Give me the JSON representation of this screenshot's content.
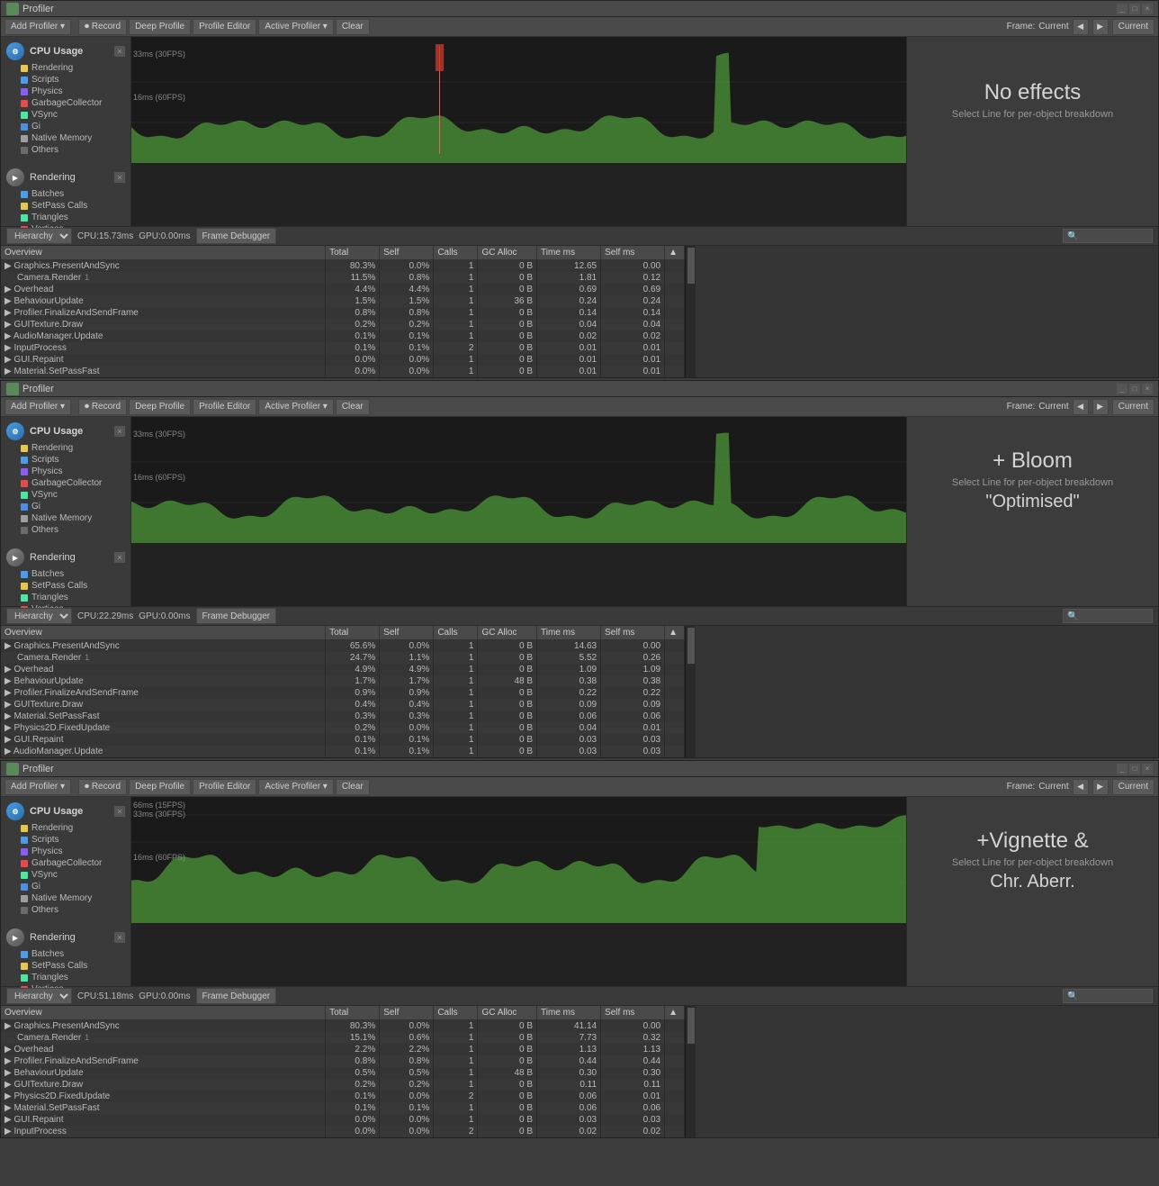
{
  "windows": [
    {
      "id": "window1",
      "titleBar": "Profiler",
      "toolbar": {
        "addProfiler": "Add Profiler",
        "record": "Record",
        "deepProfile": "Deep Profile",
        "profileEditor": "Profile Editor",
        "activeProfiler": "Active Profiler",
        "clear": "Clear",
        "frame": "Frame:",
        "current": "Current",
        "currentBtn": "Current"
      },
      "cpu": {
        "label": "CPU Usage",
        "items": [
          {
            "color": "#e8c84a",
            "label": "Rendering"
          },
          {
            "color": "#4a9de8",
            "label": "Scripts"
          },
          {
            "color": "#8b5cf6",
            "label": "Physics"
          },
          {
            "color": "#e84a4a",
            "label": "GarbageCollector"
          },
          {
            "color": "#4ae8a0",
            "label": "VSync"
          },
          {
            "color": "#4a90e8",
            "label": "Gi"
          },
          {
            "color": "#9e9e9e",
            "label": "Native Memory"
          },
          {
            "color": "#6b6b6b",
            "label": "Others"
          }
        ],
        "chart30fps": "33ms (30FPS)",
        "chart60fps": "16ms (60FPS)"
      },
      "rendering": {
        "label": "Rendering",
        "items": [
          {
            "color": "#4a9de8",
            "label": "Batches"
          },
          {
            "color": "#e8c84a",
            "label": "SetPass Calls"
          },
          {
            "color": "#4ae8a0",
            "label": "Triangles"
          },
          {
            "color": "#e84a4a",
            "label": "Vertices"
          }
        ]
      },
      "bottomBar": {
        "hierarchy": "Hierarchy",
        "cpu": "CPU:15.73ms",
        "gpu": "GPU:0.00ms",
        "frameDebugger": "Frame Debugger"
      },
      "table": {
        "headers": [
          "Overview",
          "Total",
          "Self",
          "Calls",
          "GC Alloc",
          "Time ms",
          "Self ms",
          ""
        ],
        "rows": [
          {
            "name": "Graphics.PresentAndSync",
            "total": "80.3%",
            "self": "0.0%",
            "calls": "1",
            "gcAlloc": "0 B",
            "timeMs": "12.65",
            "selfMs": "0.00",
            "indent": 0
          },
          {
            "name": "Camera.Render",
            "total": "11.5%",
            "self": "0.8%",
            "calls": "1",
            "gcAlloc": "0 B",
            "timeMs": "1.81",
            "selfMs": "0.12",
            "indent": 1,
            "extra": "1"
          },
          {
            "name": "Overhead",
            "total": "4.4%",
            "self": "4.4%",
            "calls": "1",
            "gcAlloc": "0 B",
            "timeMs": "0.69",
            "selfMs": "0.69",
            "indent": 0
          },
          {
            "name": "BehaviourUpdate",
            "total": "1.5%",
            "self": "1.5%",
            "calls": "1",
            "gcAlloc": "36 B",
            "timeMs": "0.24",
            "selfMs": "0.24",
            "indent": 0
          },
          {
            "name": "Profiler.FinalizeAndSendFrame",
            "total": "0.8%",
            "self": "0.8%",
            "calls": "1",
            "gcAlloc": "0 B",
            "timeMs": "0.14",
            "selfMs": "0.14",
            "indent": 0
          },
          {
            "name": "GUITexture.Draw",
            "total": "0.2%",
            "self": "0.2%",
            "calls": "1",
            "gcAlloc": "0 B",
            "timeMs": "0.04",
            "selfMs": "0.04",
            "indent": 0
          },
          {
            "name": "AudioManager.Update",
            "total": "0.1%",
            "self": "0.1%",
            "calls": "1",
            "gcAlloc": "0 B",
            "timeMs": "0.02",
            "selfMs": "0.02",
            "indent": 0
          },
          {
            "name": "InputProcess",
            "total": "0.1%",
            "self": "0.1%",
            "calls": "2",
            "gcAlloc": "0 B",
            "timeMs": "0.01",
            "selfMs": "0.01",
            "indent": 0
          },
          {
            "name": "GUI.Repaint",
            "total": "0.0%",
            "self": "0.0%",
            "calls": "1",
            "gcAlloc": "0 B",
            "timeMs": "0.01",
            "selfMs": "0.01",
            "indent": 0
          },
          {
            "name": "Material.SetPassFast",
            "total": "0.0%",
            "self": "0.0%",
            "calls": "1",
            "gcAlloc": "0 B",
            "timeMs": "0.01",
            "selfMs": "0.01",
            "indent": 0
          }
        ]
      },
      "infoPanel": {
        "title": "No effects",
        "subtitle": "Select Line for per-object breakdown"
      }
    },
    {
      "id": "window2",
      "titleBar": "Profiler",
      "toolbar": {
        "addProfiler": "Add Profiler",
        "record": "Record",
        "deepProfile": "Deep Profile",
        "profileEditor": "Profile Editor",
        "activeProfiler": "Active Profiler",
        "clear": "Clear",
        "frame": "Frame:",
        "current": "Current",
        "currentBtn": "Current"
      },
      "cpu": {
        "label": "CPU Usage",
        "chart30fps": "33ms (30FPS)",
        "chart60fps": "16ms (60FPS)",
        "items": [
          {
            "color": "#e8c84a",
            "label": "Rendering"
          },
          {
            "color": "#4a9de8",
            "label": "Scripts"
          },
          {
            "color": "#8b5cf6",
            "label": "Physics"
          },
          {
            "color": "#e84a4a",
            "label": "GarbageCollector"
          },
          {
            "color": "#4ae8a0",
            "label": "VSync"
          },
          {
            "color": "#4a90e8",
            "label": "Gi"
          },
          {
            "color": "#9e9e9e",
            "label": "Native Memory"
          },
          {
            "color": "#6b6b6b",
            "label": "Others"
          }
        ]
      },
      "rendering": {
        "label": "Rendering",
        "items": [
          {
            "color": "#4a9de8",
            "label": "Batches"
          },
          {
            "color": "#e8c84a",
            "label": "SetPass Calls"
          },
          {
            "color": "#4ae8a0",
            "label": "Triangles"
          },
          {
            "color": "#e84a4a",
            "label": "Vertices"
          }
        ]
      },
      "bottomBar": {
        "hierarchy": "Hierarchy",
        "cpu": "CPU:22.29ms",
        "gpu": "GPU:0.00ms",
        "frameDebugger": "Frame Debugger"
      },
      "table": {
        "headers": [
          "Overview",
          "Total",
          "Self",
          "Calls",
          "GC Alloc",
          "Time ms",
          "Self ms",
          ""
        ],
        "rows": [
          {
            "name": "Graphics.PresentAndSync",
            "total": "65.6%",
            "self": "0.0%",
            "calls": "1",
            "gcAlloc": "0 B",
            "timeMs": "14.63",
            "selfMs": "0.00",
            "indent": 0
          },
          {
            "name": "Camera.Render",
            "total": "24.7%",
            "self": "1.1%",
            "calls": "1",
            "gcAlloc": "0 B",
            "timeMs": "5.52",
            "selfMs": "0.26",
            "indent": 1,
            "extra": "1"
          },
          {
            "name": "Overhead",
            "total": "4.9%",
            "self": "4.9%",
            "calls": "1",
            "gcAlloc": "0 B",
            "timeMs": "1.09",
            "selfMs": "1.09",
            "indent": 0
          },
          {
            "name": "BehaviourUpdate",
            "total": "1.7%",
            "self": "1.7%",
            "calls": "1",
            "gcAlloc": "48 B",
            "timeMs": "0.38",
            "selfMs": "0.38",
            "indent": 0
          },
          {
            "name": "Profiler.FinalizeAndSendFrame",
            "total": "0.9%",
            "self": "0.9%",
            "calls": "1",
            "gcAlloc": "0 B",
            "timeMs": "0.22",
            "selfMs": "0.22",
            "indent": 0
          },
          {
            "name": "GUITexture.Draw",
            "total": "0.4%",
            "self": "0.4%",
            "calls": "1",
            "gcAlloc": "0 B",
            "timeMs": "0.09",
            "selfMs": "0.09",
            "indent": 0
          },
          {
            "name": "Material.SetPassFast",
            "total": "0.3%",
            "self": "0.3%",
            "calls": "1",
            "gcAlloc": "0 B",
            "timeMs": "0.06",
            "selfMs": "0.06",
            "indent": 0
          },
          {
            "name": "Physics2D.FixedUpdate",
            "total": "0.2%",
            "self": "0.0%",
            "calls": "1",
            "gcAlloc": "0 B",
            "timeMs": "0.04",
            "selfMs": "0.01",
            "indent": 0
          },
          {
            "name": "GUI.Repaint",
            "total": "0.1%",
            "self": "0.1%",
            "calls": "1",
            "gcAlloc": "0 B",
            "timeMs": "0.03",
            "selfMs": "0.03",
            "indent": 0
          },
          {
            "name": "AudioManager.Update",
            "total": "0.1%",
            "self": "0.1%",
            "calls": "1",
            "gcAlloc": "0 B",
            "timeMs": "0.03",
            "selfMs": "0.03",
            "indent": 0
          }
        ]
      },
      "infoPanel": {
        "title": "+ Bloom",
        "subtitle": "Select Line for per-object breakdown",
        "subtitle2": "\"Optimised\""
      }
    },
    {
      "id": "window3",
      "titleBar": "Profiler",
      "toolbar": {
        "addProfiler": "Add Profiler",
        "record": "Record",
        "deepProfile": "Deep Profile",
        "profileEditor": "Profile Editor",
        "activeProfiler": "Active Profiler",
        "clear": "Clear",
        "frame": "Frame:",
        "current": "Current",
        "currentBtn": "Current"
      },
      "cpu": {
        "label": "CPU Usage",
        "chart15fps": "66ms (15FPS)",
        "chart30fps": "33ms (30FPS)",
        "chart60fps": "16ms (60FPS)",
        "items": [
          {
            "color": "#e8c84a",
            "label": "Rendering"
          },
          {
            "color": "#4a9de8",
            "label": "Scripts"
          },
          {
            "color": "#8b5cf6",
            "label": "Physics"
          },
          {
            "color": "#e84a4a",
            "label": "GarbageCollector"
          },
          {
            "color": "#4ae8a0",
            "label": "VSync"
          },
          {
            "color": "#4a90e8",
            "label": "Gi"
          },
          {
            "color": "#9e9e9e",
            "label": "Native Memory"
          },
          {
            "color": "#6b6b6b",
            "label": "Others"
          }
        ]
      },
      "rendering": {
        "label": "Rendering",
        "items": [
          {
            "color": "#4a9de8",
            "label": "Batches"
          },
          {
            "color": "#e8c84a",
            "label": "SetPass Calls"
          },
          {
            "color": "#4ae8a0",
            "label": "Triangles"
          },
          {
            "color": "#e84a4a",
            "label": "Vertices"
          }
        ]
      },
      "bottomBar": {
        "hierarchy": "Hierarchy",
        "cpu": "CPU:51.18ms",
        "gpu": "GPU:0.00ms",
        "frameDebugger": "Frame Debugger"
      },
      "table": {
        "headers": [
          "Overview",
          "Total",
          "Self",
          "Calls",
          "GC Alloc",
          "Time ms",
          "Self ms",
          ""
        ],
        "rows": [
          {
            "name": "Graphics.PresentAndSync",
            "total": "80.3%",
            "self": "0.0%",
            "calls": "1",
            "gcAlloc": "0 B",
            "timeMs": "41.14",
            "selfMs": "0.00",
            "indent": 0
          },
          {
            "name": "Camera.Render",
            "total": "15.1%",
            "self": "0.6%",
            "calls": "1",
            "gcAlloc": "0 B",
            "timeMs": "7.73",
            "selfMs": "0.32",
            "indent": 1,
            "extra": "1"
          },
          {
            "name": "Overhead",
            "total": "2.2%",
            "self": "2.2%",
            "calls": "1",
            "gcAlloc": "0 B",
            "timeMs": "1.13",
            "selfMs": "1.13",
            "indent": 0
          },
          {
            "name": "Profiler.FinalizeAndSendFrame",
            "total": "0.8%",
            "self": "0.8%",
            "calls": "1",
            "gcAlloc": "0 B",
            "timeMs": "0.44",
            "selfMs": "0.44",
            "indent": 0
          },
          {
            "name": "BehaviourUpdate",
            "total": "0.5%",
            "self": "0.5%",
            "calls": "1",
            "gcAlloc": "48 B",
            "timeMs": "0.30",
            "selfMs": "0.30",
            "indent": 0
          },
          {
            "name": "GUITexture.Draw",
            "total": "0.2%",
            "self": "0.2%",
            "calls": "1",
            "gcAlloc": "0 B",
            "timeMs": "0.11",
            "selfMs": "0.11",
            "indent": 0
          },
          {
            "name": "Physics2D.FixedUpdate",
            "total": "0.1%",
            "self": "0.0%",
            "calls": "2",
            "gcAlloc": "0 B",
            "timeMs": "0.06",
            "selfMs": "0.01",
            "indent": 0
          },
          {
            "name": "Material.SetPassFast",
            "total": "0.1%",
            "self": "0.1%",
            "calls": "1",
            "gcAlloc": "0 B",
            "timeMs": "0.06",
            "selfMs": "0.06",
            "indent": 0
          },
          {
            "name": "GUI.Repaint",
            "total": "0.0%",
            "self": "0.0%",
            "calls": "1",
            "gcAlloc": "0 B",
            "timeMs": "0.03",
            "selfMs": "0.03",
            "indent": 0
          },
          {
            "name": "InputProcess",
            "total": "0.0%",
            "self": "0.0%",
            "calls": "2",
            "gcAlloc": "0 B",
            "timeMs": "0.02",
            "selfMs": "0.02",
            "indent": 0
          }
        ]
      },
      "infoPanel": {
        "title": "+Vignette &",
        "subtitle": "Select Line for per-object breakdown",
        "subtitle2": "Chr. Aberr."
      }
    }
  ]
}
